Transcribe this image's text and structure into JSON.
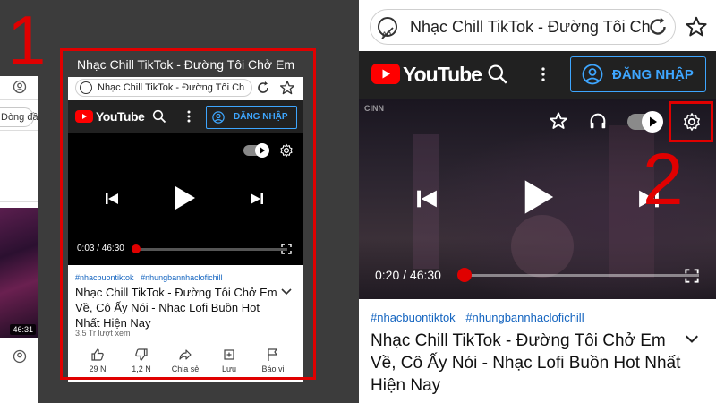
{
  "left": {
    "chip": "Dòng đầ",
    "duration": "46:31"
  },
  "middle": {
    "step_number": "1",
    "card_title": "Nhạc Chill TikTok - Đường Tôi Chở Em",
    "url_text": "Nhạc Chill TikTok - Đường Tôi Ch",
    "logo_text": "YouTube",
    "login_label": "ĐĂNG NHẬP",
    "time": "0:03 / 46:30",
    "progress_fraction": 0.001,
    "tags": [
      "#nhacbuontiktok",
      "#nhungbannhaclofichill"
    ],
    "video_title": "Nhạc Chill TikTok - Đường Tôi Chở Em Về, Cô Ấy Nói - Nhạc Lofi Buồn Hot Nhất Hiện Nay",
    "views": "3,5 Tr lượt xem",
    "actions": [
      {
        "label": "29 N",
        "icon": "thumb-up-icon"
      },
      {
        "label": "1,2 N",
        "icon": "thumb-down-icon"
      },
      {
        "label": "Chia sẻ",
        "icon": "share-icon"
      },
      {
        "label": "Lưu",
        "icon": "save-playlist-icon"
      },
      {
        "label": "Báo vi phạm",
        "icon": "flag-icon"
      }
    ]
  },
  "right": {
    "step_number": "2",
    "url_text": "Nhạc Chill TikTok - Đường Tôi Ch",
    "logo_text": "YouTube",
    "login_label": "ĐĂNG NHẬP",
    "watermark": "CINN",
    "time": "0:20 / 46:30",
    "progress_fraction": 0.007,
    "tags": [
      "#nhacbuontiktok",
      "#nhungbannhaclofichill"
    ],
    "video_title": "Nhạc Chill TikTok - Đường Tôi Chở Em Về, Cô Ấy Nói - Nhạc Lofi Buồn Hot Nhất Hiện Nay"
  },
  "colors": {
    "highlight": "#e00000",
    "youtube_red": "#ff0000",
    "link_blue": "#1565c0",
    "login_blue": "#3ea6ff"
  }
}
